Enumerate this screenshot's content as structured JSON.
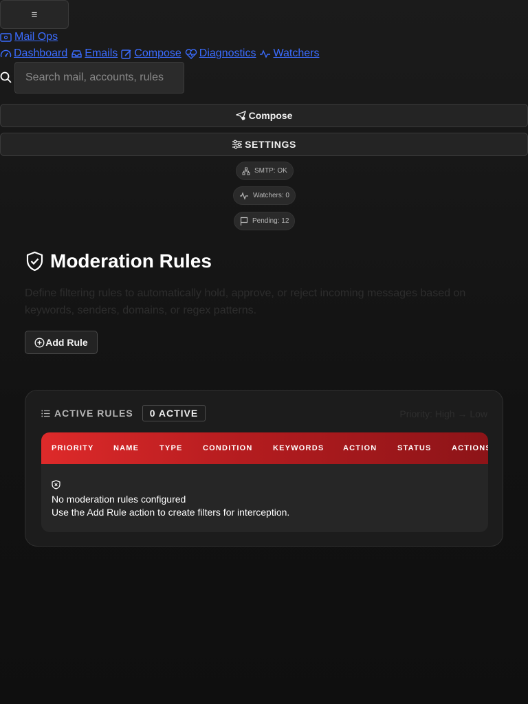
{
  "header": {
    "menu_glyph": "≡",
    "brand": "Mail Ops",
    "nav": [
      {
        "label": "Dashboard",
        "icon": "gauge-icon"
      },
      {
        "label": "Emails",
        "icon": "inbox-icon"
      },
      {
        "label": "Compose",
        "icon": "pencil-square-icon"
      },
      {
        "label": "Diagnostics",
        "icon": "heart-pulse-icon"
      },
      {
        "label": "Watchers",
        "icon": "activity-icon"
      }
    ],
    "search_placeholder": "Search mail, accounts, rules"
  },
  "actions": {
    "compose_label": "Compose",
    "settings_label": "SETTINGS"
  },
  "status": {
    "smtp": "SMTP: OK",
    "watchers": "Watchers: 0",
    "pending": "Pending: 12"
  },
  "page": {
    "title": "Moderation Rules",
    "description": "Define filtering rules to automatically hold, approve, or reject incoming messages based on keywords, senders, domains, or regex patterns.",
    "add_rule_label": "Add Rule"
  },
  "rules_panel": {
    "title": "ACTIVE RULES",
    "count_badge": "0 ACTIVE",
    "priority_hint": "Priority: High → Low",
    "columns": [
      "PRIORITY",
      "NAME",
      "TYPE",
      "CONDITION",
      "KEYWORDS",
      "ACTION",
      "STATUS",
      "ACTIONS"
    ],
    "empty_title": "No moderation rules configured",
    "empty_subtitle": "Use the Add Rule action to create filters for interception."
  },
  "colors": {
    "accent_red": "#de2a2a",
    "link_blue": "#3b6cff",
    "background": "#141414"
  }
}
